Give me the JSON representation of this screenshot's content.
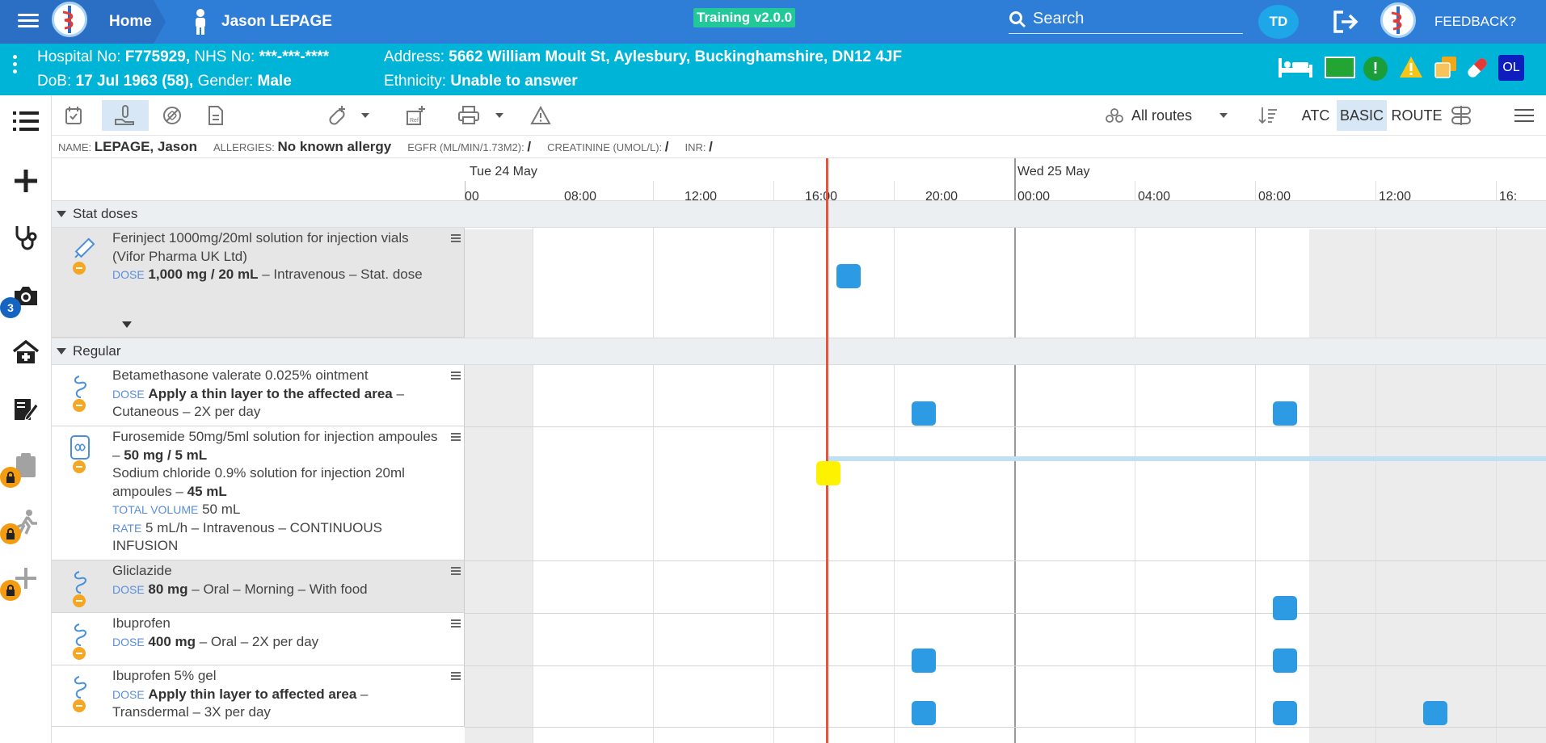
{
  "topbar": {
    "home_label": "Home",
    "patient_name": "Jason LEPAGE",
    "version": "Training v2.0.0",
    "search_placeholder": "Search",
    "user_initials": "TD",
    "feedback_label": "FEEDBACK?"
  },
  "banner": {
    "hospital_no_label": "Hospital No:",
    "hospital_no": "F775929,",
    "nhs_label": "NHS No:",
    "nhs_no": "***-***-****",
    "dob_label": "DoB:",
    "dob": "17 Jul 1963 (58),",
    "gender_label": "Gender:",
    "gender": "Male",
    "address_label": "Address:",
    "address": "5662 William Moult St, Aylesbury, Buckinghamshire, DN12 4JF",
    "ethnicity_label": "Ethnicity:",
    "ethnicity": "Unable to answer",
    "user_badge": "OL"
  },
  "rail": {
    "notification_count": "3"
  },
  "toolbar": {
    "routes_label": "All routes",
    "atc_label": "ATC",
    "basic_label": "BASIC",
    "route_label": "ROUTE"
  },
  "info": {
    "name_label": "NAME:",
    "name": "LEPAGE, Jason",
    "allergies_label": "ALLERGIES:",
    "allergies": "No known allergy",
    "egfr_label": "EGFR (ML/MIN/1.73M2):",
    "egfr": "/",
    "creat_label": "CREATININE (UMOL/L):",
    "creat": "/",
    "inr_label": "INR:",
    "inr": "/"
  },
  "timeline": {
    "day1": "Tue 24 May",
    "day2": "Wed 25 May",
    "ticks": [
      "00",
      "08:00",
      "12:00",
      "16:00",
      "20:00",
      "00:00",
      "04:00",
      "08:00",
      "12:00",
      "16:"
    ]
  },
  "sections": {
    "stat": "Stat doses",
    "regular": "Regular"
  },
  "drugs": [
    {
      "name": "Ferinject 1000mg/20ml solution for injection vials (Vifor Pharma UK Ltd)",
      "dose_label": "DOSE",
      "dose": "1,000 mg / 20 mL",
      "rest": " – Intravenous – Stat. dose"
    },
    {
      "name": "Betamethasone valerate 0.025% ointment",
      "dose_label": "DOSE",
      "dose": "Apply a thin layer to the affected area",
      "rest": " – Cutaneous – 2X per day"
    },
    {
      "name": "Furosemide 50mg/5ml solution for injection ampoules – ",
      "dose": "50 mg / 5 mL",
      "name2": "Sodium chloride 0.9% solution for injection 20ml ampoules – ",
      "dose2": "45 mL",
      "total_label": "TOTAL VOLUME",
      "total": "50 mL",
      "rate_label": "RATE",
      "rate": "5 mL/h – Intravenous – CONTINUOUS INFUSION"
    },
    {
      "name": "Gliclazide",
      "dose_label": "DOSE",
      "dose": "80 mg",
      "rest": " – Oral – Morning – With food"
    },
    {
      "name": "Ibuprofen",
      "dose_label": "DOSE",
      "dose": "400 mg",
      "rest": " – Oral – 2X per day"
    },
    {
      "name": "Ibuprofen 5% gel",
      "dose_label": "DOSE",
      "dose": "Apply thin layer to affected area",
      "rest": " – Transdermal – 3X per day"
    }
  ],
  "colors": {
    "topbar": "#2e7dd7",
    "banner": "#00b4d8",
    "dose": "#2d9be3",
    "now_line": "#e8553e",
    "pending": "#fff200",
    "infusion": "#bfe0f5"
  }
}
